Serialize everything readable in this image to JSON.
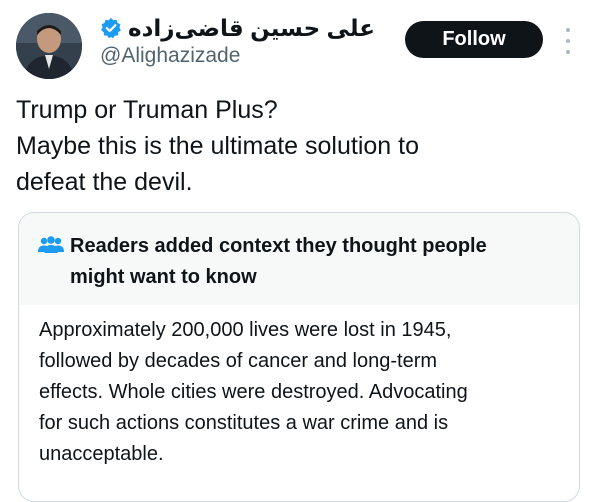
{
  "author": {
    "display_name": "علی حسین قاضی‌زاده",
    "handle": "@Alighazizade",
    "verified": true
  },
  "follow_label": "Follow",
  "tweet_lines": [
    "Trump or Truman Plus?",
    "Maybe this is the ultimate solution to",
    "defeat the devil."
  ],
  "community_note": {
    "title_lines": [
      "Readers added context they thought people",
      "might want to know"
    ],
    "body_lines": [
      "Approximately 200,000 lives were lost in 1945,",
      "followed by decades of cancer and long-term",
      "effects. Whole cities were destroyed. Advocating",
      "for such actions constitutes a war crime and is",
      "unacceptable."
    ]
  },
  "colors": {
    "text": "#0f1419",
    "secondary": "#536471",
    "verified": "#1d9bf0",
    "note_header_bg": "#f7f9f9",
    "border": "#cfd9de"
  },
  "icons": {
    "verified": "verified-badge-icon",
    "more": "more-options-icon",
    "note": "people-icon"
  }
}
